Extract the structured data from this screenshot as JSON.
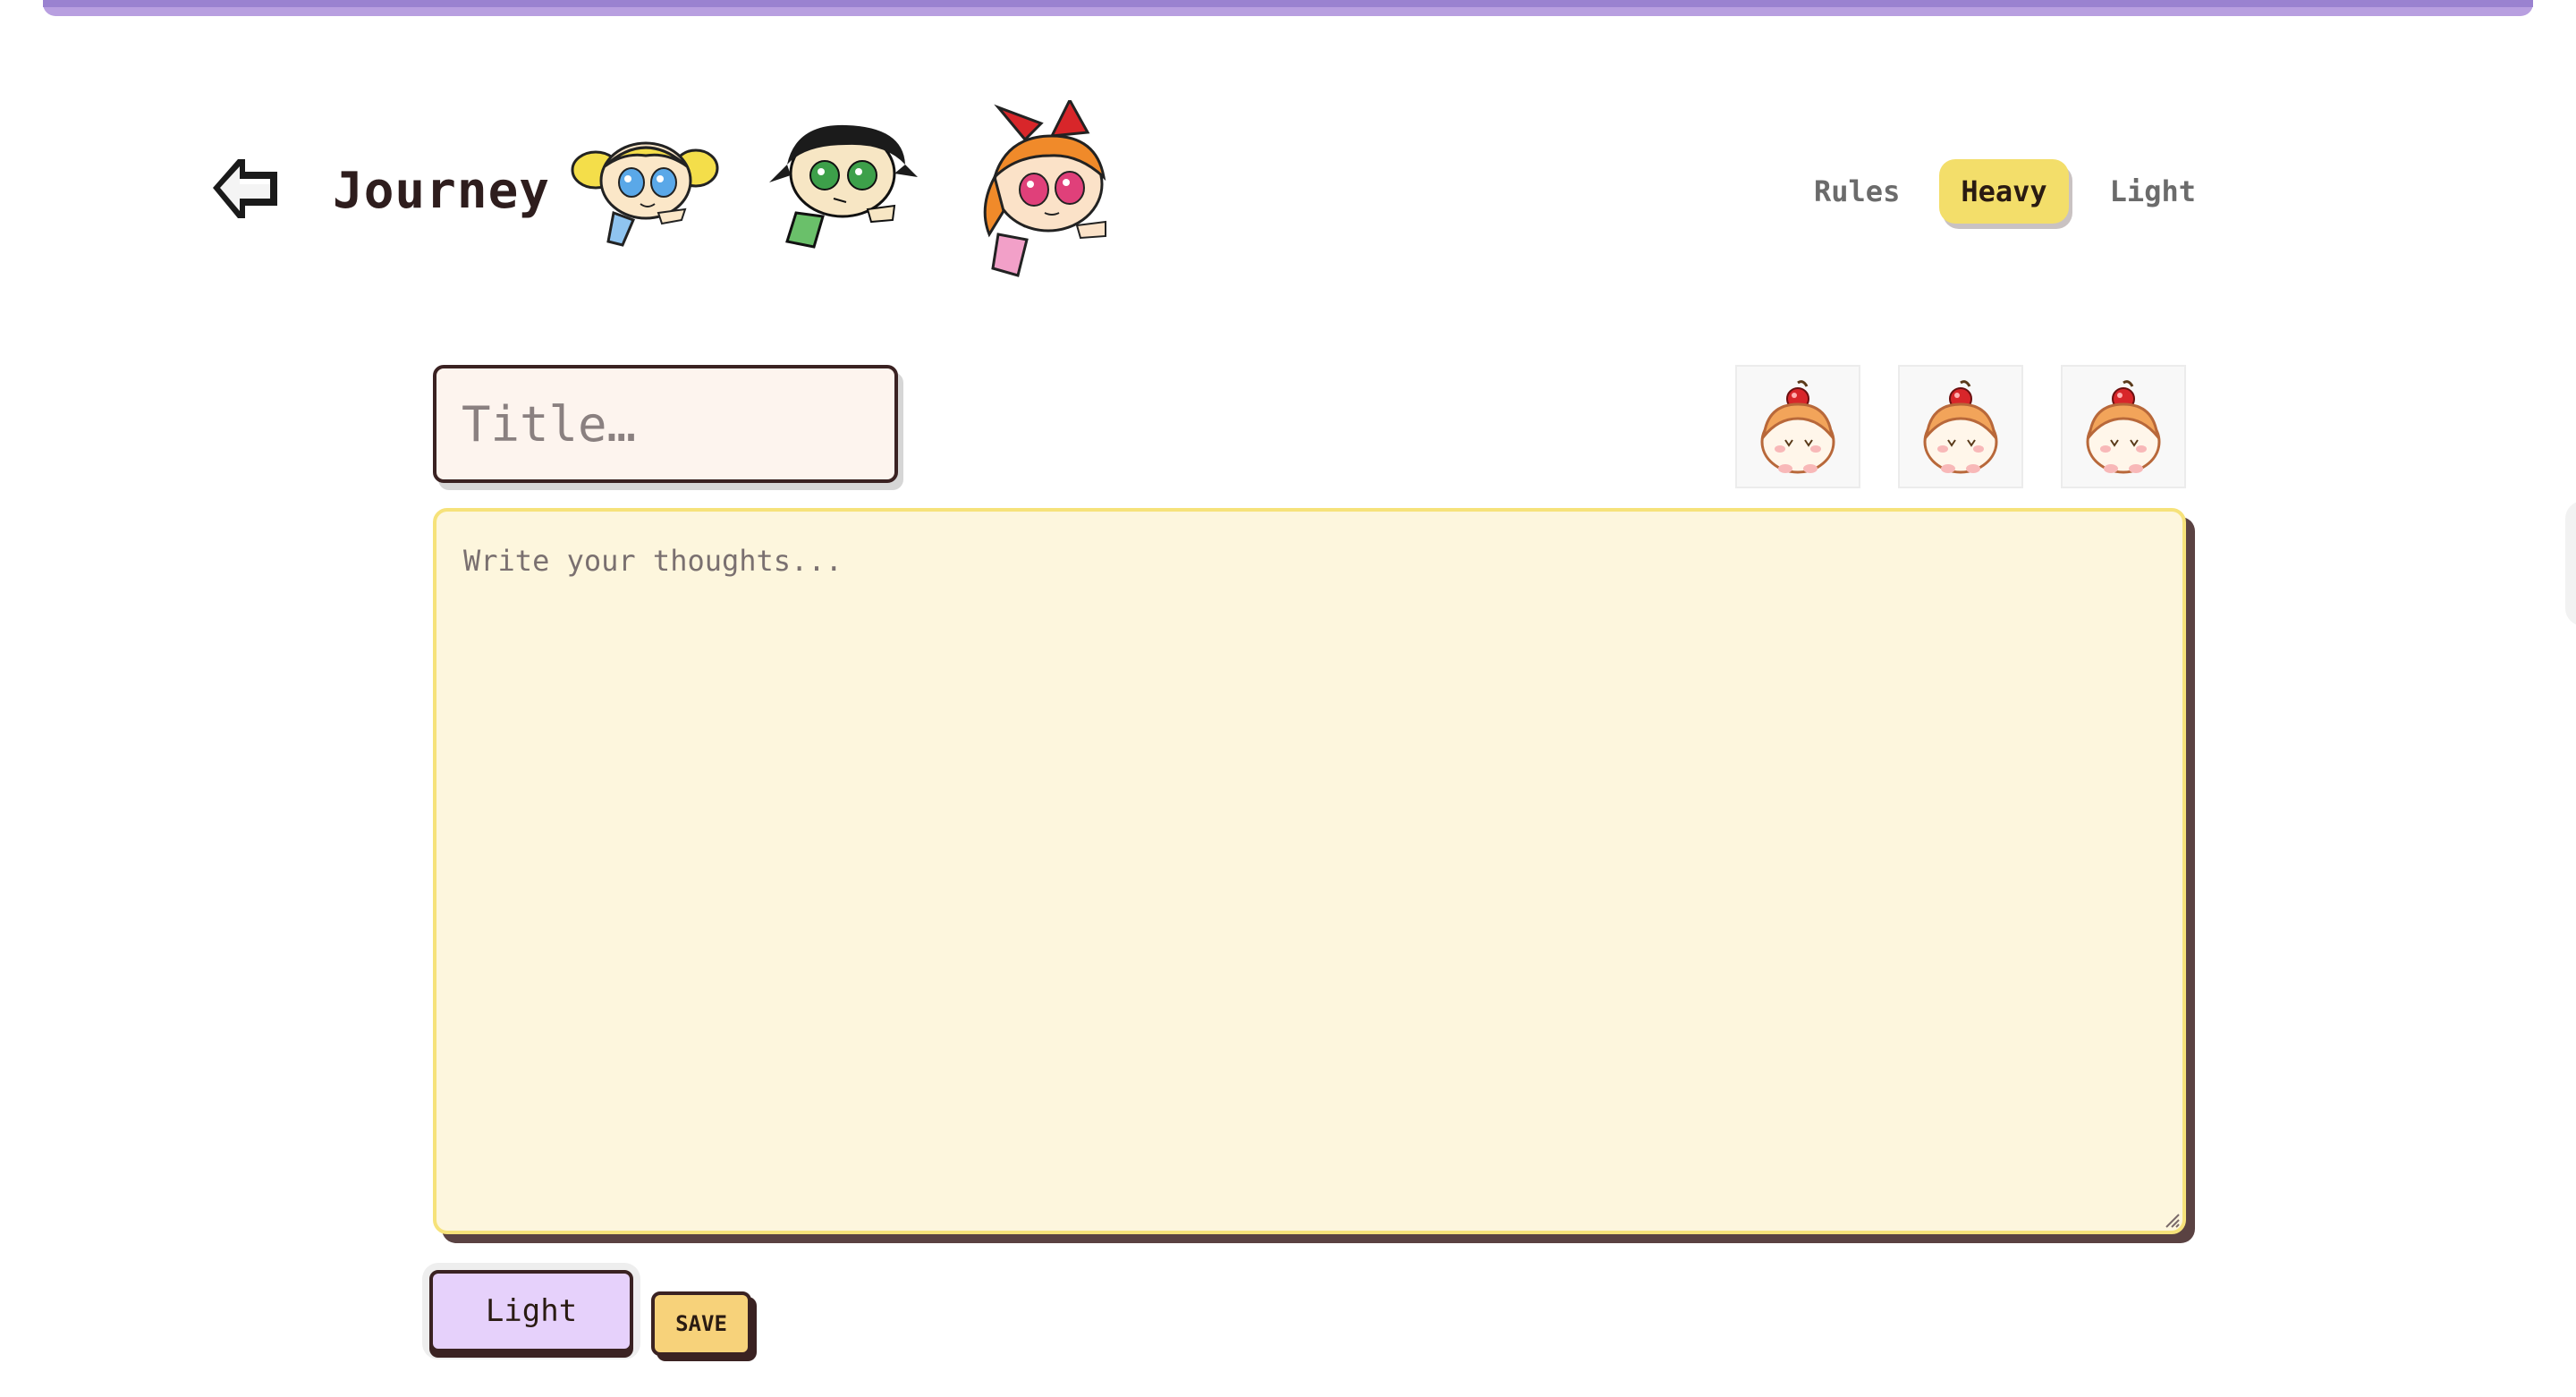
{
  "header": {
    "title": "Journey",
    "back_icon": "left-arrow-icon",
    "mascots": [
      "bubbles-icon",
      "buttercup-icon",
      "blossom-icon"
    ]
  },
  "nav": {
    "tabs": [
      {
        "label": "Rules",
        "active": false
      },
      {
        "label": "Heavy",
        "active": true
      },
      {
        "label": "Light",
        "active": false
      }
    ]
  },
  "editor": {
    "title_placeholder": "Title…",
    "body_placeholder": "Write your thoughts...",
    "stickers": [
      "hamster-cherry-icon",
      "hamster-cherry-icon",
      "hamster-cherry-icon"
    ]
  },
  "actions": {
    "mode_label": "Light",
    "save_label": "SAVE"
  },
  "colors": {
    "accent_purple": "#b89fe0",
    "active_tab": "#f3de6a",
    "editor_bg": "#fdf6dd",
    "save_button": "#f7d27a",
    "mode_button": "#e6d1fb"
  }
}
